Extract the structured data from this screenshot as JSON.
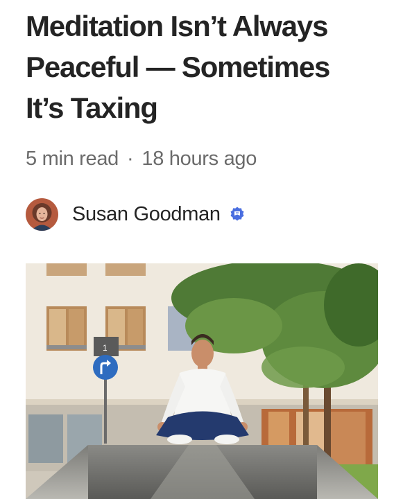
{
  "article": {
    "title_lines": [
      "Meditation Isn’t Always",
      "Peaceful — Sometimes",
      "It’s Taxing"
    ],
    "read_time": "5 min read",
    "separator": "·",
    "published": "18 hours ago"
  },
  "author": {
    "name": "Susan Goodman",
    "badge_icon": "member-verified-icon",
    "badge_color": "#4a6ee0"
  },
  "hero_image": {
    "description_icon": "photo-man-meditating-on-bench",
    "sign_icon": "turn-right-arrow-icon",
    "sign_number": "1"
  }
}
